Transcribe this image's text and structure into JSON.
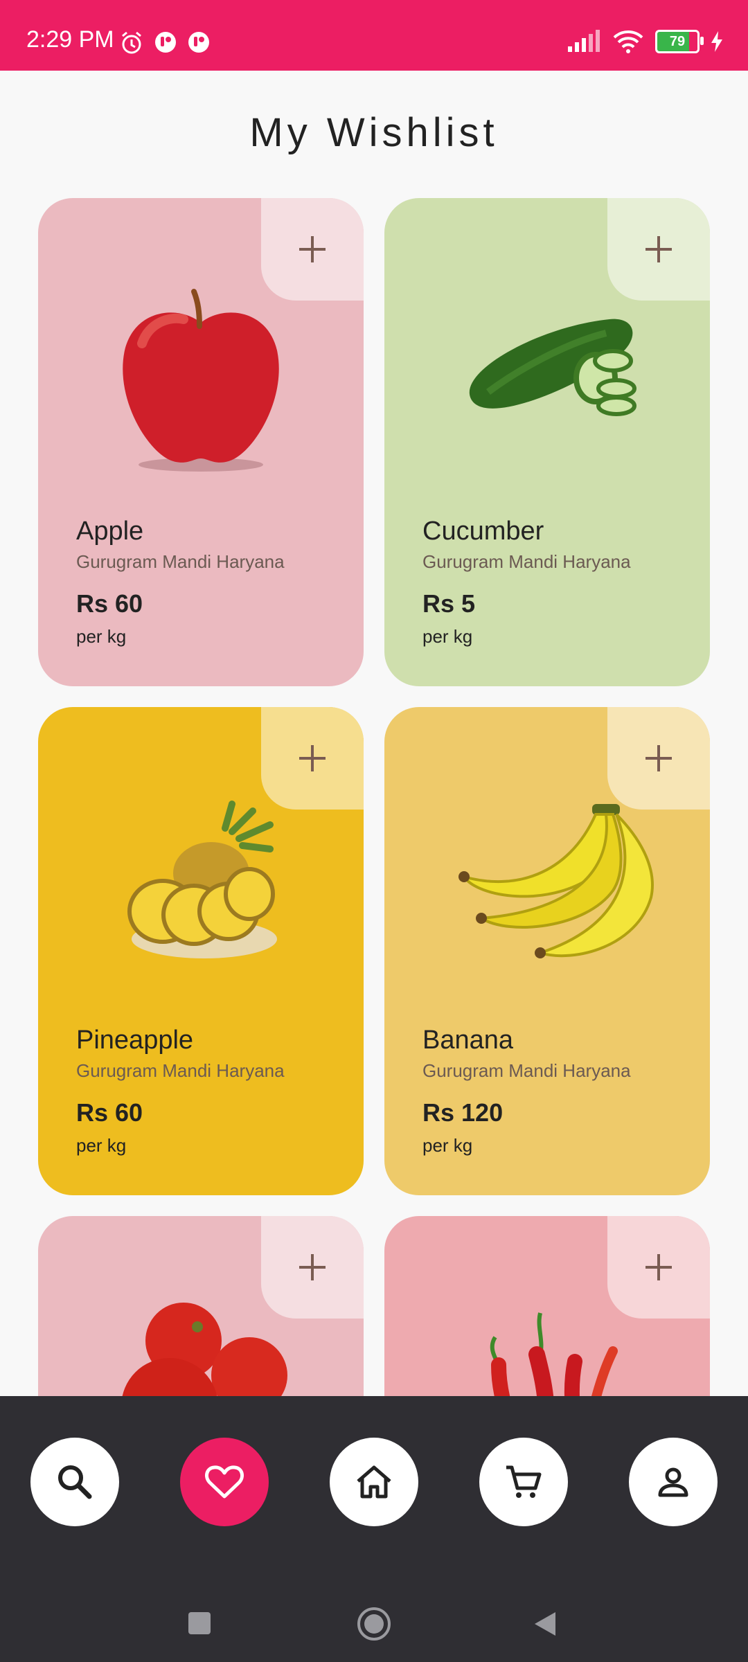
{
  "status": {
    "time": "2:29 PM",
    "battery": "79"
  },
  "page": {
    "title": "My Wishlist"
  },
  "products": [
    {
      "name": "Apple",
      "location": "Gurugram Mandi Haryana",
      "price": "Rs 60",
      "unit": "per kg",
      "bg": "#ebbac0",
      "plus_bg": "#f5dee1"
    },
    {
      "name": "Cucumber",
      "location": "Gurugram Mandi Haryana",
      "price": "Rs 5",
      "unit": "per kg",
      "bg": "#cfdfad",
      "plus_bg": "#e7efd6"
    },
    {
      "name": "Pineapple",
      "location": "Gurugram Mandi Haryana",
      "price": "Rs 60",
      "unit": "per kg",
      "bg": "#eebd1f",
      "plus_bg": "#f6de8f"
    },
    {
      "name": "Banana",
      "location": "Gurugram Mandi Haryana",
      "price": "Rs 120",
      "unit": "per kg",
      "bg": "#eeca6a",
      "plus_bg": "#f7e5b5"
    },
    {
      "name": "Tomato",
      "location": "",
      "price": "",
      "unit": "",
      "bg": "#ebbac0",
      "plus_bg": "#f5dee1"
    },
    {
      "name": "Chilli",
      "location": "",
      "price": "",
      "unit": "",
      "bg": "#eeaaaf",
      "plus_bg": "#f7d6d8"
    }
  ],
  "nav": [
    {
      "icon": "search-icon"
    },
    {
      "icon": "heart-icon",
      "active": true
    },
    {
      "icon": "home-icon"
    },
    {
      "icon": "cart-icon"
    },
    {
      "icon": "profile-icon"
    }
  ],
  "colors": {
    "accent": "#ec1e63",
    "nav_bg": "#2f2e33"
  }
}
